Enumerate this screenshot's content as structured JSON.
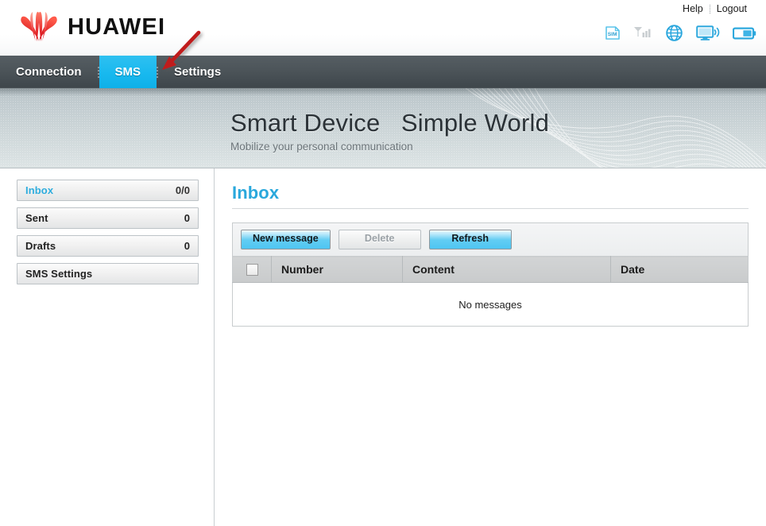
{
  "brand": {
    "name": "HUAWEI",
    "logo_color": "#e2231a",
    "accent_color": "#29b6e8"
  },
  "header": {
    "links": [
      {
        "label": "Help",
        "name": "help-link"
      },
      {
        "label": "Logout",
        "name": "logout-link"
      }
    ],
    "status_icons": [
      {
        "name": "sim-card-icon",
        "label": "SIM"
      },
      {
        "name": "signal-strength-icon",
        "label": "Signal"
      },
      {
        "name": "globe-network-icon",
        "label": "Network"
      },
      {
        "name": "wifi-monitor-icon",
        "label": "WLAN"
      },
      {
        "name": "battery-icon",
        "label": "Battery"
      }
    ]
  },
  "nav": {
    "items": [
      {
        "label": "Connection",
        "active": false
      },
      {
        "label": "SMS",
        "active": true
      },
      {
        "label": "Settings",
        "active": false
      }
    ]
  },
  "banner": {
    "title": "Smart Device   Simple World",
    "subtitle": "Mobilize your personal communication"
  },
  "sidebar": {
    "items": [
      {
        "label": "Inbox",
        "count": "0/0",
        "active": true
      },
      {
        "label": "Sent",
        "count": "0",
        "active": false
      },
      {
        "label": "Drafts",
        "count": "0",
        "active": false
      },
      {
        "label": "SMS Settings",
        "count": "",
        "active": false
      }
    ]
  },
  "main": {
    "title": "Inbox",
    "toolbar": {
      "new_message_label": "New message",
      "delete_label": "Delete",
      "refresh_label": "Refresh"
    },
    "table": {
      "columns": [
        "",
        "Number",
        "Content",
        "Date"
      ],
      "rows": [],
      "empty_text": "No messages"
    }
  }
}
